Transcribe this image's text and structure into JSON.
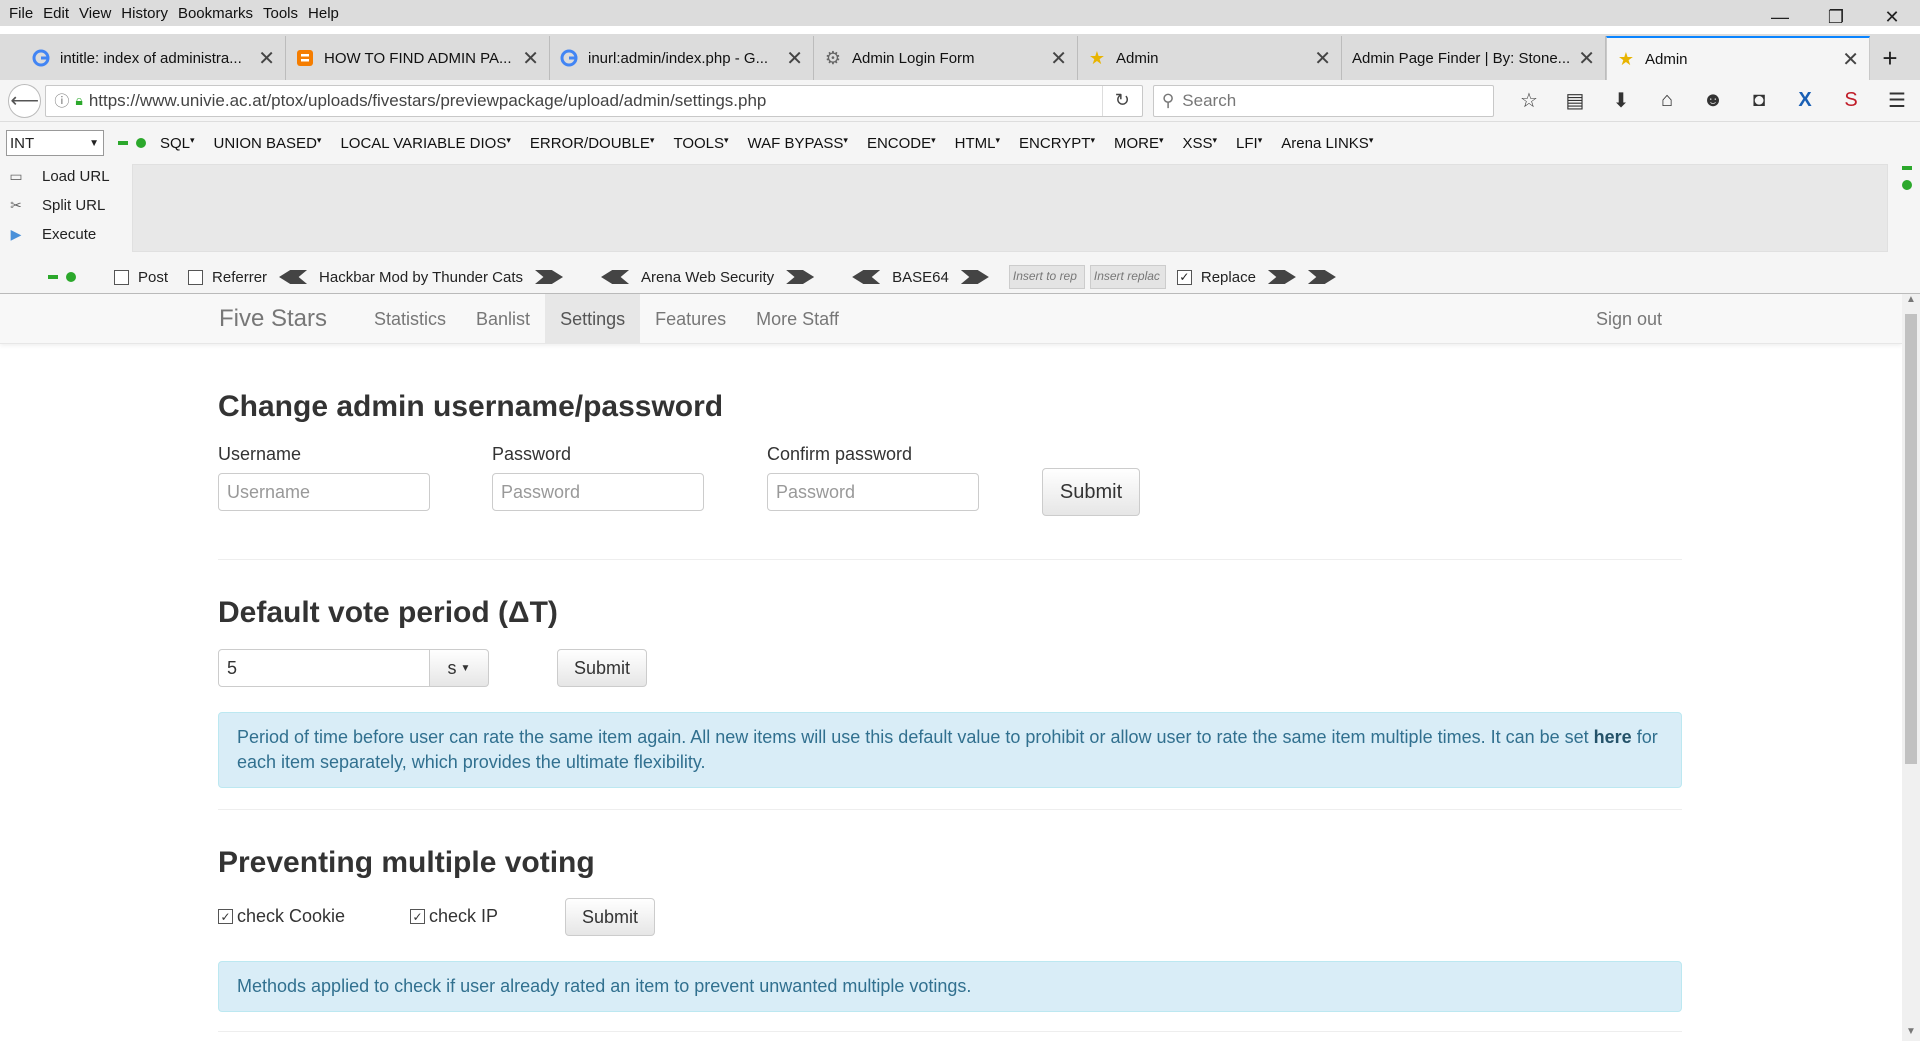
{
  "menubar": {
    "items": [
      "File",
      "Edit",
      "View",
      "History",
      "Bookmarks",
      "Tools",
      "Help"
    ],
    "mnemonics": [
      "F",
      "E",
      "V",
      "i",
      "B",
      "T",
      "H"
    ]
  },
  "tabs": [
    {
      "label": "intitle: index of administra...",
      "icon": "google-icon"
    },
    {
      "label": "HOW TO FIND ADMIN PA...",
      "icon": "blogger-icon"
    },
    {
      "label": "inurl:admin/index.php - G...",
      "icon": "google-icon"
    },
    {
      "label": "Admin Login Form",
      "icon": "gear-icon"
    },
    {
      "label": "Admin",
      "icon": "star-icon"
    },
    {
      "label": "Admin Page Finder | By: Stone...",
      "icon": ""
    },
    {
      "label": "Admin",
      "icon": "star-icon"
    }
  ],
  "navbar": {
    "url": "https://www.univie.ac.at/ptox/uploads/fivestars/previewpackage/upload/admin/settings.php",
    "search_placeholder": "Search"
  },
  "hackbar": {
    "select_value": "INT",
    "menus": [
      "SQL",
      "UNION BASED",
      "LOCAL VARIABLE DIOS",
      "ERROR/DOUBLE",
      "TOOLS",
      "WAF BYPASS",
      "ENCODE",
      "HTML",
      "ENCRYPT",
      "MORE",
      "XSS",
      "LFI",
      "Arena LINKS"
    ],
    "side": [
      "Load URL",
      "Split URL",
      "Execute"
    ],
    "post_label": "Post",
    "referrer_label": "Referrer",
    "mod_label": "Hackbar Mod by Thunder Cats",
    "arena_label": "Arena Web Security",
    "base64_label": "BASE64",
    "insert_rep": "Insert to rep",
    "insert_replac": "Insert replac",
    "replace_label": "Replace"
  },
  "site": {
    "brand": "Five Stars",
    "nav": [
      "Statistics",
      "Banlist",
      "Settings",
      "Features",
      "More Staff"
    ],
    "active_nav": "Settings",
    "signout": "Sign out"
  },
  "section1": {
    "title": "Change admin username/password",
    "username_label": "Username",
    "username_placeholder": "Username",
    "password_label": "Password",
    "password_placeholder": "Password",
    "confirm_label": "Confirm password",
    "confirm_placeholder": "Password",
    "submit": "Submit"
  },
  "section2": {
    "title": "Default vote period (ΔT)",
    "value": "5",
    "unit": "s",
    "submit": "Submit",
    "info_before": "Period of time before user can rate the same item again. All new items will use this default value to prohibit or allow user to rate the same item multiple times. It can be set ",
    "info_link": "here",
    "info_after": " for each item separately, which provides the ultimate flexibility."
  },
  "section3": {
    "title": "Preventing multiple voting",
    "check_cookie": "check Cookie",
    "check_ip": "check IP",
    "submit": "Submit",
    "info": "Methods applied to check if user already rated an item to prevent unwanted multiple votings."
  }
}
